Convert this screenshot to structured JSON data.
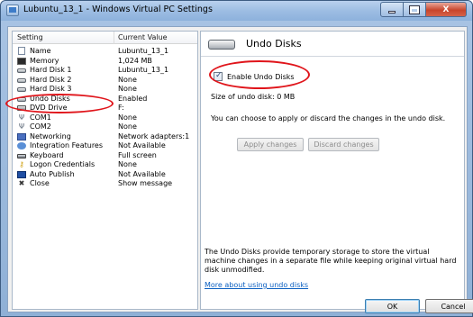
{
  "window": {
    "title": "Lubuntu_13_1 - Windows Virtual PC Settings",
    "controls": {
      "minimize": "minimize",
      "maximize": "maximize",
      "close": "X"
    }
  },
  "settings_list": {
    "headers": {
      "setting": "Setting",
      "value": "Current Value"
    },
    "selected_index": 4,
    "rows": [
      {
        "name": "Name",
        "value": "Lubuntu_13_1",
        "icon": "document-icon"
      },
      {
        "name": "Memory",
        "value": "1,024 MB",
        "icon": "memory-icon"
      },
      {
        "name": "Hard Disk 1",
        "value": "Lubuntu_13_1",
        "icon": "hard-disk-icon"
      },
      {
        "name": "Hard Disk 2",
        "value": "None",
        "icon": "hard-disk-icon"
      },
      {
        "name": "Hard Disk 3",
        "value": "None",
        "icon": "hard-disk-icon"
      },
      {
        "name": "Undo Disks",
        "value": "Enabled",
        "icon": "hard-disk-icon"
      },
      {
        "name": "DVD Drive",
        "value": "F:",
        "icon": "dvd-drive-icon"
      },
      {
        "name": "COM1",
        "value": "None",
        "icon": "com-port-icon"
      },
      {
        "name": "COM2",
        "value": "None",
        "icon": "com-port-icon"
      },
      {
        "name": "Networking",
        "value": "Network adapters:1",
        "icon": "network-icon"
      },
      {
        "name": "Integration Features",
        "value": "Not Available",
        "icon": "integration-icon"
      },
      {
        "name": "Keyboard",
        "value": "Full screen",
        "icon": "keyboard-icon"
      },
      {
        "name": "Logon Credentials",
        "value": "None",
        "icon": "key-icon"
      },
      {
        "name": "Auto Publish",
        "value": "Not Available",
        "icon": "publish-icon"
      },
      {
        "name": "Close",
        "value": "Show message",
        "icon": "close-x-icon"
      }
    ]
  },
  "detail": {
    "title": "Undo Disks",
    "checkbox_label": "Enable Undo Disks",
    "checkbox_checked": true,
    "size_text": "Size of undo disk: 0 MB",
    "info_text": "You can choose to apply or discard the changes in the undo disk.",
    "apply_label": "Apply changes",
    "discard_label": "Discard changes",
    "description": "The Undo Disks provide temporary storage to store the virtual machine changes in a separate file while keeping original virtual hard disk unmodified.",
    "link_text": "More about using undo disks"
  },
  "footer": {
    "ok_label": "OK",
    "cancel_label": "Cancel"
  },
  "colors": {
    "annotation_red": "#e0151b",
    "link_blue": "#0b5fc1"
  }
}
